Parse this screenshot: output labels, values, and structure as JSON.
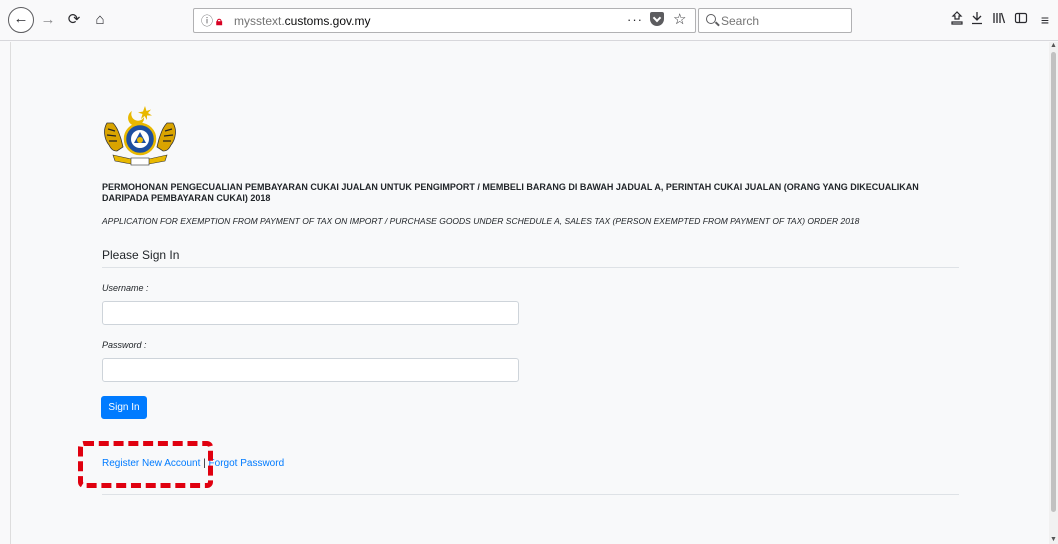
{
  "browser": {
    "url_host_prefix": "mysstext.",
    "url_domain": "customs.gov.my",
    "url_overflow": "···",
    "search_placeholder": "Search",
    "icons": {
      "back": "←",
      "forward": "→",
      "reload": "⟳",
      "home": "⌂",
      "info": "ⓘ",
      "star": "☆",
      "reader": "⌂",
      "download": "⤓",
      "library": "|||\\",
      "sidebar": "◫",
      "menu": "≡"
    }
  },
  "page": {
    "title_malay": "PERMOHONAN PENGECUALIAN PEMBAYARAN CUKAI JUALAN UNTUK PENGIMPORT / MEMBELI BARANG DI BAWAH JADUAL A, PERINTAH CUKAI JUALAN (ORANG YANG DIKECUALIKAN DARIPADA PEMBAYARAN CUKAI) 2018",
    "title_english": "APPLICATION FOR EXEMPTION FROM PAYMENT OF TAX ON IMPORT / PURCHASE GOODS UNDER SCHEDULE A, SALES TAX (PERSON EXEMPTED FROM PAYMENT OF TAX) ORDER 2018",
    "signin_heading": "Please Sign In",
    "username_label": "Username :",
    "username_value": "",
    "password_label": "Password :",
    "password_value": "",
    "signin_button": "Sign In",
    "register_link": "Register New Account",
    "separator": " | ",
    "forgot_link": "Forgot Password"
  },
  "colors": {
    "primary": "#007bff",
    "highlight": "#e0000f"
  }
}
